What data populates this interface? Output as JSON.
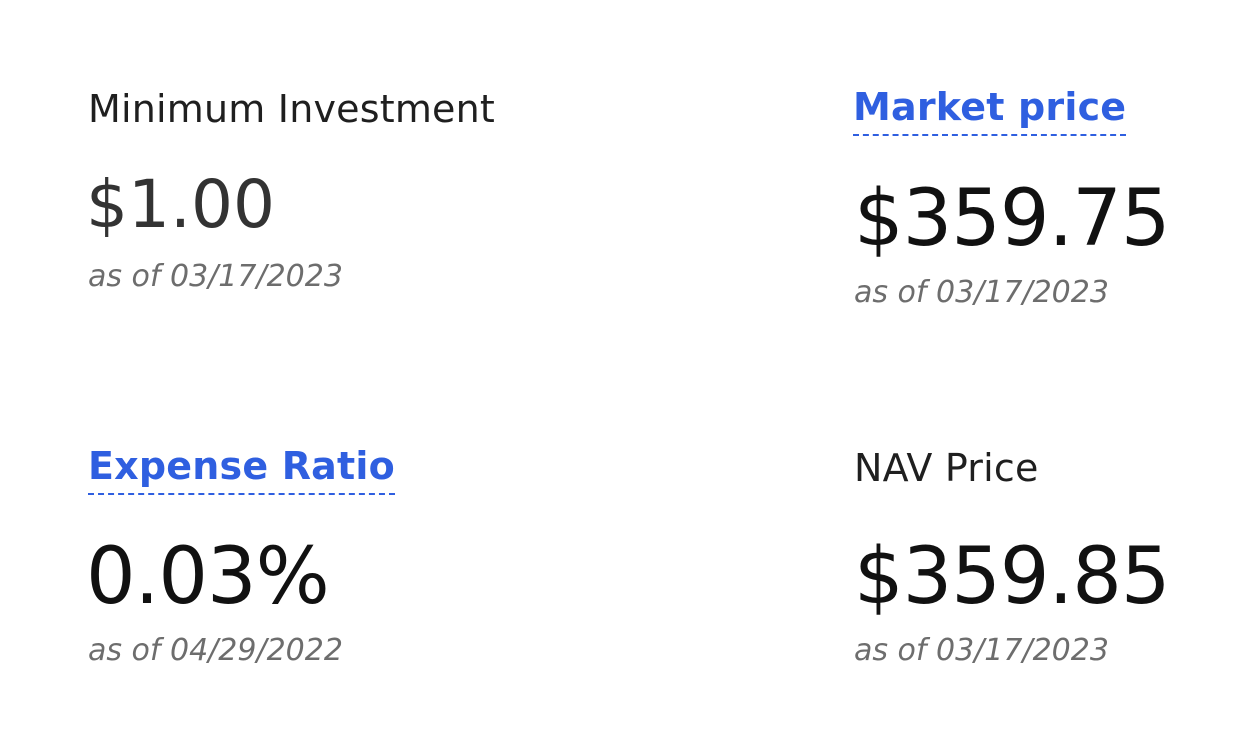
{
  "metrics": {
    "minimum_investment": {
      "label": "Minimum Investment",
      "value": "$1.00",
      "as_of": "as of 03/17/2023"
    },
    "market_price": {
      "label": "Market price",
      "value": "$359.75",
      "as_of": "as of 03/17/2023"
    },
    "expense_ratio": {
      "label": "Expense Ratio",
      "value": "0.03%",
      "as_of": "as of 04/29/2022"
    },
    "nav_price": {
      "label": "NAV Price",
      "value": "$359.85",
      "as_of": "as of 03/17/2023"
    }
  },
  "colors": {
    "link": "#2f5fe0",
    "text": "#1f1f1f",
    "muted": "#6d6d6d"
  }
}
